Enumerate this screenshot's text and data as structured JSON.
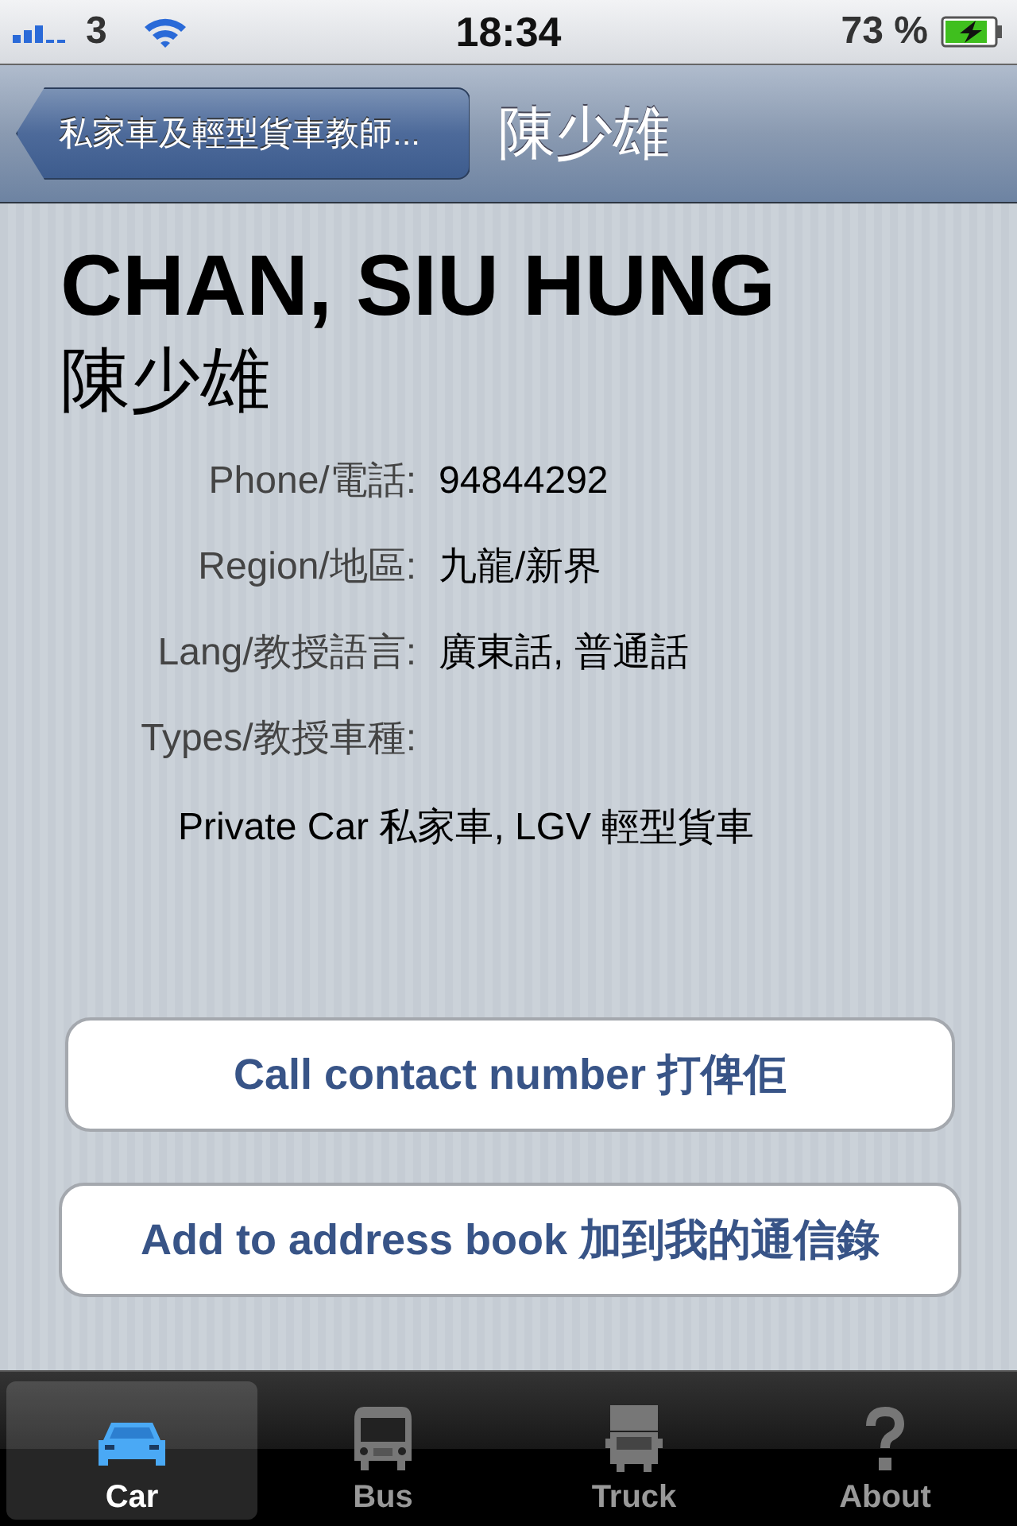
{
  "status_bar": {
    "carrier": "3",
    "time": "18:34",
    "battery": "73 %",
    "charging": true
  },
  "nav_bar": {
    "back": "私家車及輕型貨車教師...",
    "title": "陳少雄"
  },
  "contact": {
    "name": "CHAN, SIU HUNG",
    "name_chinese": "陳少雄",
    "fields": [
      {
        "kind": "inline",
        "label": "Phone/電話:",
        "value": "94844292"
      },
      {
        "kind": "inline",
        "label": "Region/地區:",
        "value": "九龍/新界"
      },
      {
        "kind": "inline",
        "label": "Lang/教授語言:",
        "value": "廣東話, 普通話"
      },
      {
        "kind": "stacked",
        "label": "Types/教授車種:",
        "value": "Private Car 私家車, LGV 輕型貨車"
      }
    ]
  },
  "buttons": [
    {
      "label": "Call contact number 打俾佢"
    },
    {
      "label": "Add to address book 加到我的通信錄"
    }
  ],
  "tabs": [
    {
      "kind": "car",
      "label": "Car",
      "selected": true
    },
    {
      "kind": "bus",
      "label": "Bus",
      "selected": false
    },
    {
      "kind": "truck",
      "label": "Truck",
      "selected": false
    },
    {
      "kind": "help",
      "label": "About",
      "selected": false
    }
  ]
}
